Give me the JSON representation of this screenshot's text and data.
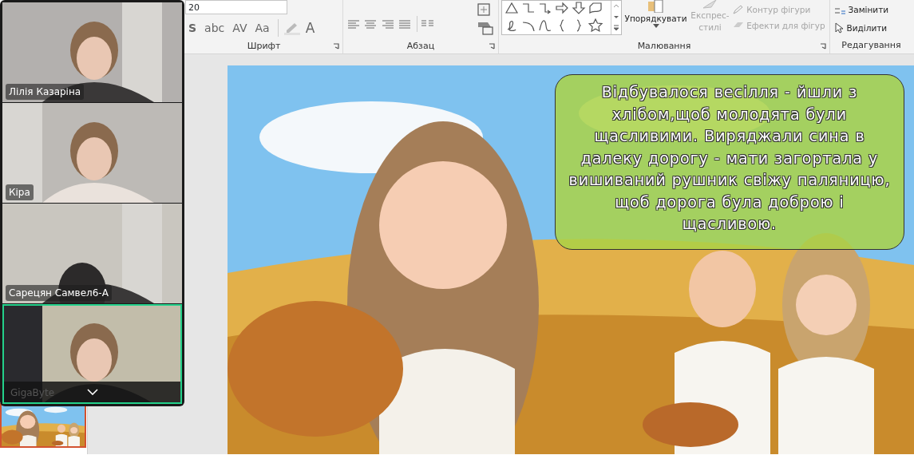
{
  "ribbon": {
    "font_size": "20",
    "font_buttons": [
      {
        "label": "S"
      },
      {
        "label": "abc"
      },
      {
        "label": "AV"
      },
      {
        "label": "Aa"
      }
    ],
    "font_color_button": {
      "label": "A"
    },
    "groups": [
      {
        "label": "Шрифт"
      },
      {
        "label": "Абзац"
      },
      {
        "label": "Малювання"
      },
      {
        "label": "Редагування"
      }
    ],
    "arrange_button": {
      "label": "Упорядкувати",
      "disabled": false
    },
    "quick_styles_button": {
      "lines": [
        "Експрес-",
        "стилі"
      ],
      "disabled": true
    },
    "shape_commands": [
      {
        "label": "Контур фігури",
        "disabled": true
      },
      {
        "label": "Ефекти для фігур",
        "disabled": true
      }
    ],
    "editing_commands": [
      {
        "label": "Замінити",
        "disabled": false
      },
      {
        "label": "Виділити",
        "disabled": false
      }
    ]
  },
  "video_panel": {
    "participants": [
      {
        "name": "Лілія Казаріна",
        "highlighted": false
      },
      {
        "name": "Кіра",
        "highlighted": false
      },
      {
        "name": "Сарецян Самвел6-А",
        "highlighted": false
      },
      {
        "name": "GigaByte",
        "highlighted": true
      }
    ]
  },
  "slide": {
    "caption": "Відбувалося весілля - йшли з хлібом,щоб молодята були щасливими. Виряджали сина в далеку дорогу - мати загортала у вишиваний рушник свіжу паляницю, щоб дорога була доброю і щасливою."
  }
}
